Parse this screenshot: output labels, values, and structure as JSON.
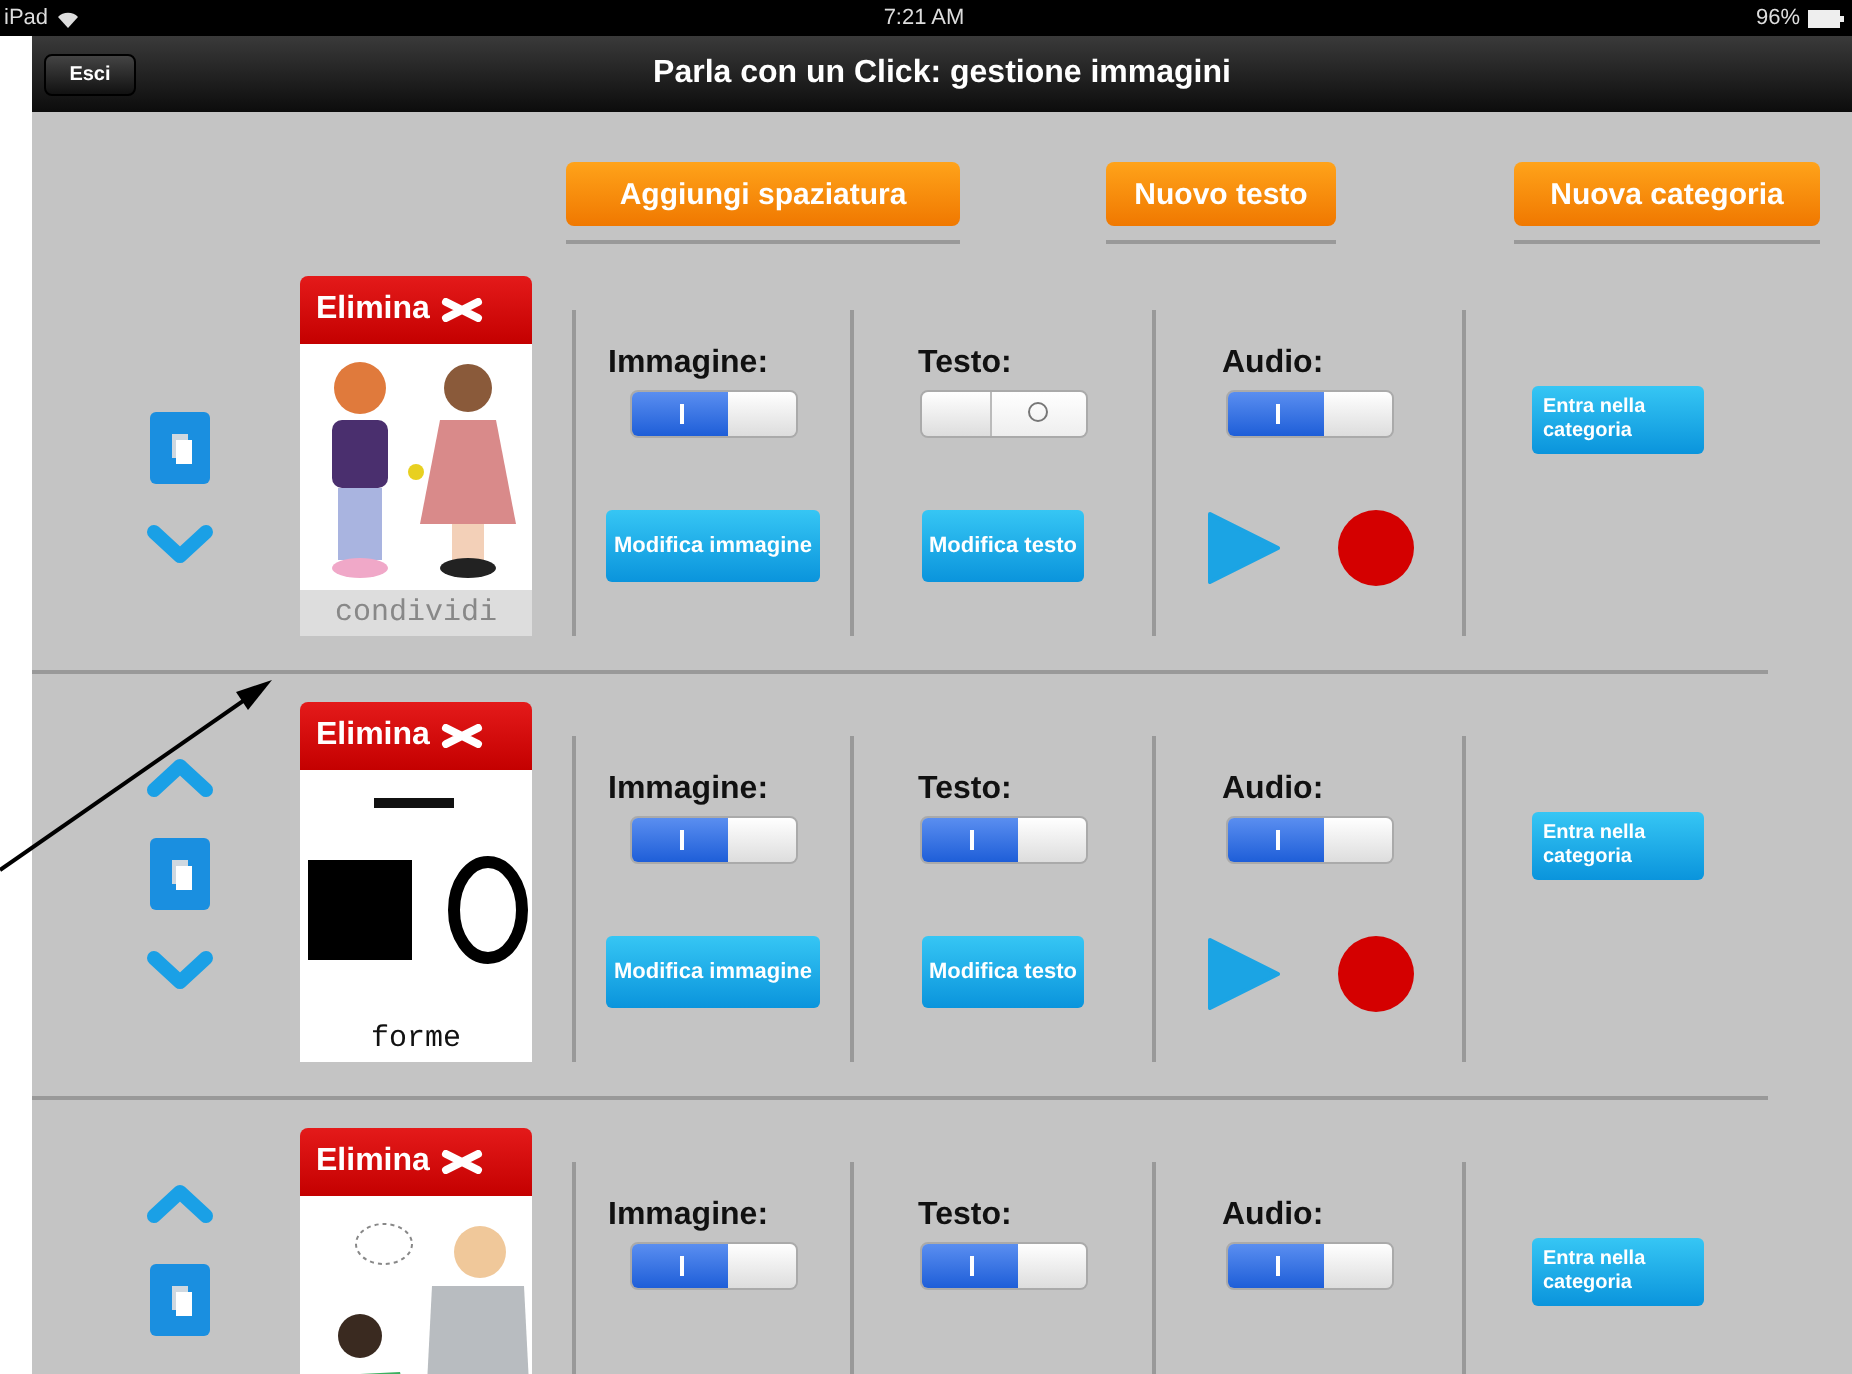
{
  "status_bar": {
    "device": "iPad",
    "time": "7:21 AM",
    "battery": "96%"
  },
  "nav_bar": {
    "back_button": "Esci",
    "title": "Parla con un Click: gestione immagini"
  },
  "toolbar": [
    "Aggiungi spaziatura",
    "Nuovo testo",
    "Nuova categoria"
  ],
  "items": [
    {
      "can_move_up": false,
      "can_move_down": true,
      "delete_label": "Elimina",
      "caption": "condividi",
      "image_label": "Immagine:",
      "image_on": true,
      "image_button": "Modifica immagine",
      "text_label": "Testo:",
      "text_on": false,
      "text_button": "Modifica testo",
      "audio_label": "Audio:",
      "audio_on": true,
      "category_button": "Entra nella categoria"
    },
    {
      "can_move_up": true,
      "can_move_down": true,
      "delete_label": "Elimina",
      "caption": "forme",
      "image_label": "Immagine:",
      "image_on": true,
      "image_button": "Modifica immagine",
      "text_label": "Testo:",
      "text_on": true,
      "text_button": "Modifica testo",
      "audio_label": "Audio:",
      "audio_on": true,
      "category_button": "Entra nella categoria"
    },
    {
      "can_move_up": true,
      "delete_label": "Elimina",
      "image_label": "Immagine:",
      "image_on": true,
      "text_label": "Testo:",
      "text_on": true,
      "audio_label": "Audio:",
      "audio_on": true,
      "category_button": "Entra nella categoria"
    }
  ]
}
